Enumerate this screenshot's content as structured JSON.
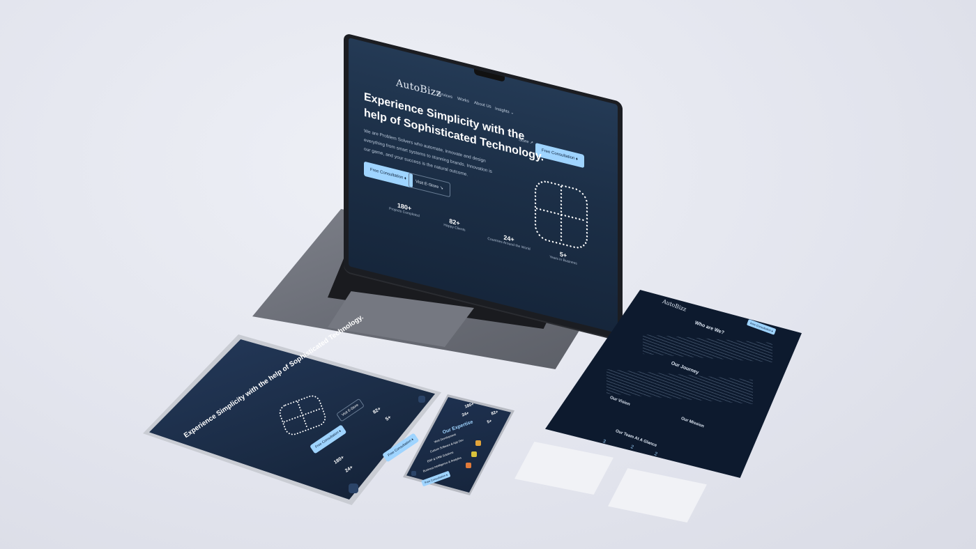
{
  "laptop": {
    "brand": "AutoBizz",
    "nav": [
      "Services",
      "Works",
      "About Us",
      "Insights ⌄",
      "Store ↗"
    ],
    "cta": "Free Consultation ⬧",
    "headline": "Experience Simplicity with the help of Sophisticated Technology.",
    "paragraph": "We are Problem Solvers who automate, innovate and design everything from smart systems to stunning brands. Innovation is our game, and your success is the natural outcome.",
    "primary_button": "Free Consultation ⬧",
    "secondary_button": "Visit E-Store ↘",
    "stats": [
      {
        "value": "180+",
        "label": "Projects Completed"
      },
      {
        "value": "82+",
        "label": "Happy Clients"
      },
      {
        "value": "24+",
        "label": "Countries Around the World"
      },
      {
        "value": "5+",
        "label": "Years in Business"
      }
    ]
  },
  "tablet": {
    "headline": "Experience Simplicity with the help of Sophisticated Technology.",
    "button": "Free Consultation ⬧",
    "button2": "Visit E-Store",
    "stats": [
      "180+",
      "24+",
      "82+",
      "5+"
    ],
    "cta": "Free Consultation ⬧"
  },
  "phone": {
    "stats": [
      "180+",
      "82+",
      "24+",
      "5+"
    ],
    "section_title": "Our Expertise",
    "items": [
      "Web Development",
      "Custom Software & App Dev",
      "ERP & CRM Solutions",
      "Business Intelligence & Analytics"
    ],
    "cta": "Free Consultation ⬧"
  },
  "poster": {
    "brand": "AutoBizz",
    "cta": "Free Consultation ⬧",
    "who_title": "Who are We?",
    "journey_title": "Our Journey",
    "vision_title": "Our Vision",
    "mission_title": "Our Mission",
    "team_title": "Our Team At A Glance",
    "team_numbers": [
      "3",
      "2",
      "2"
    ]
  }
}
